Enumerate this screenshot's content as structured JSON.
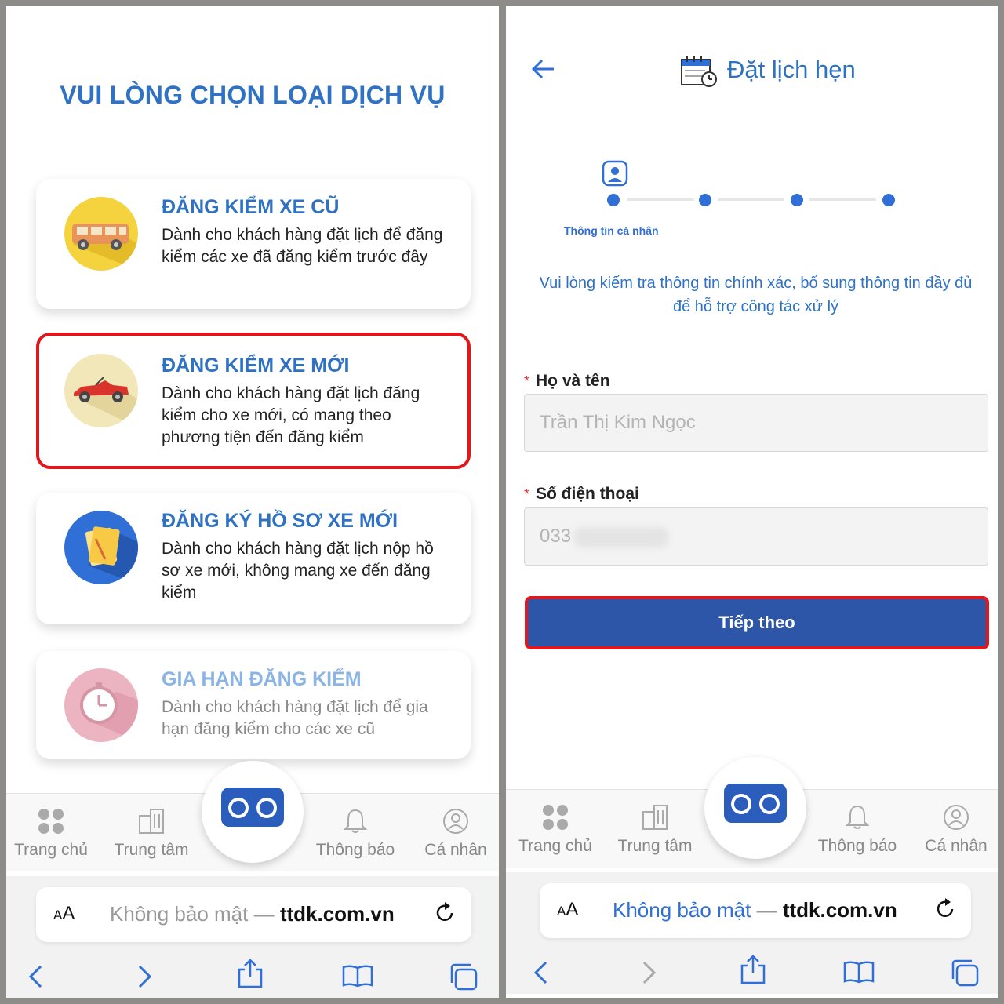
{
  "left": {
    "heading": "VUI LÒNG CHỌN LOẠI DỊCH VỤ",
    "cards": [
      {
        "title": "ĐĂNG KIỂM XE CŨ",
        "desc": "Dành cho khách hàng đặt lịch để đăng kiểm các xe đã đăng kiểm trước đây",
        "icon": "van-icon"
      },
      {
        "title": "ĐĂNG KIỂM XE MỚI",
        "desc": "Dành cho khách hàng đặt lịch đăng kiểm cho xe mới, có mang theo phương tiện đến đăng kiểm",
        "icon": "convertible-car-icon",
        "selected": true
      },
      {
        "title": "ĐĂNG KÝ HỒ SƠ XE MỚI",
        "desc": "Dành cho khách hàng đặt lịch nộp hồ sơ xe mới, không mang xe đến đăng kiểm",
        "icon": "documents-icon"
      },
      {
        "title": "GIA HẠN ĐĂNG KIỂM",
        "desc": "Dành cho khách hàng đặt lịch để gia hạn đăng kiểm cho các xe cũ",
        "icon": "stopwatch-icon",
        "disabled": true
      }
    ]
  },
  "nav": {
    "home": "Trang chủ",
    "center": "Trung tâm",
    "notify": "Thông báo",
    "profile": "Cá nhân"
  },
  "browser": {
    "aa": "A",
    "aa_big": "A",
    "insecure": "Không bảo mật",
    "dash": "—",
    "domain": "ttdk.com.vn"
  },
  "right": {
    "title": "Đặt lịch hẹn",
    "step_label": "Thông tin cá nhân",
    "instruction": "Vui lòng kiểm tra thông tin chính xác, bổ sung thông tin đầy đủ để hỗ trợ công tác xử lý",
    "required_mark": "*",
    "name_label": "Họ và tên",
    "name_value": "Trần Thị Kim Ngọc",
    "phone_label": "Số điện thoại",
    "phone_value": "033",
    "next_button": "Tiếp theo"
  },
  "colors": {
    "primary": "#2f72c4",
    "button": "#2d56a8",
    "highlight": "#e3161b"
  }
}
